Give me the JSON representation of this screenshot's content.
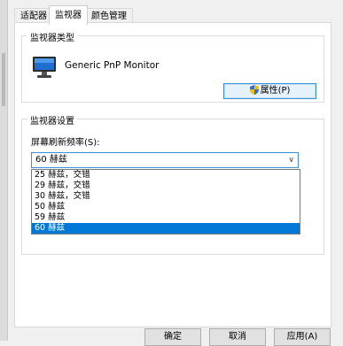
{
  "tabs": [
    "适配器",
    "监视器",
    "颜色管理"
  ],
  "monitor_type": {
    "group_title": "监视器类型",
    "monitor_name": "Generic PnP Monitor",
    "properties_button": "属性(P)"
  },
  "monitor_settings": {
    "group_title": "监视器设置",
    "refresh_label": "屏幕刷新频率(S):",
    "refresh_value": "60 赫兹",
    "refresh_options": [
      "25 赫兹，交错",
      "29 赫兹，交错",
      "30 赫兹，交错",
      "50 赫兹",
      "59 赫兹",
      "60 赫兹"
    ],
    "selected_index": 5
  },
  "footer_buttons": [
    "确定",
    "取消",
    "应用(A)"
  ],
  "icons": {
    "monitor": "monitor-icon",
    "shield": "uac-shield-icon",
    "dropdown": "chevron-down-icon"
  },
  "colors": {
    "accent": "#0078d7",
    "focus_border": "#3c8ed6"
  }
}
